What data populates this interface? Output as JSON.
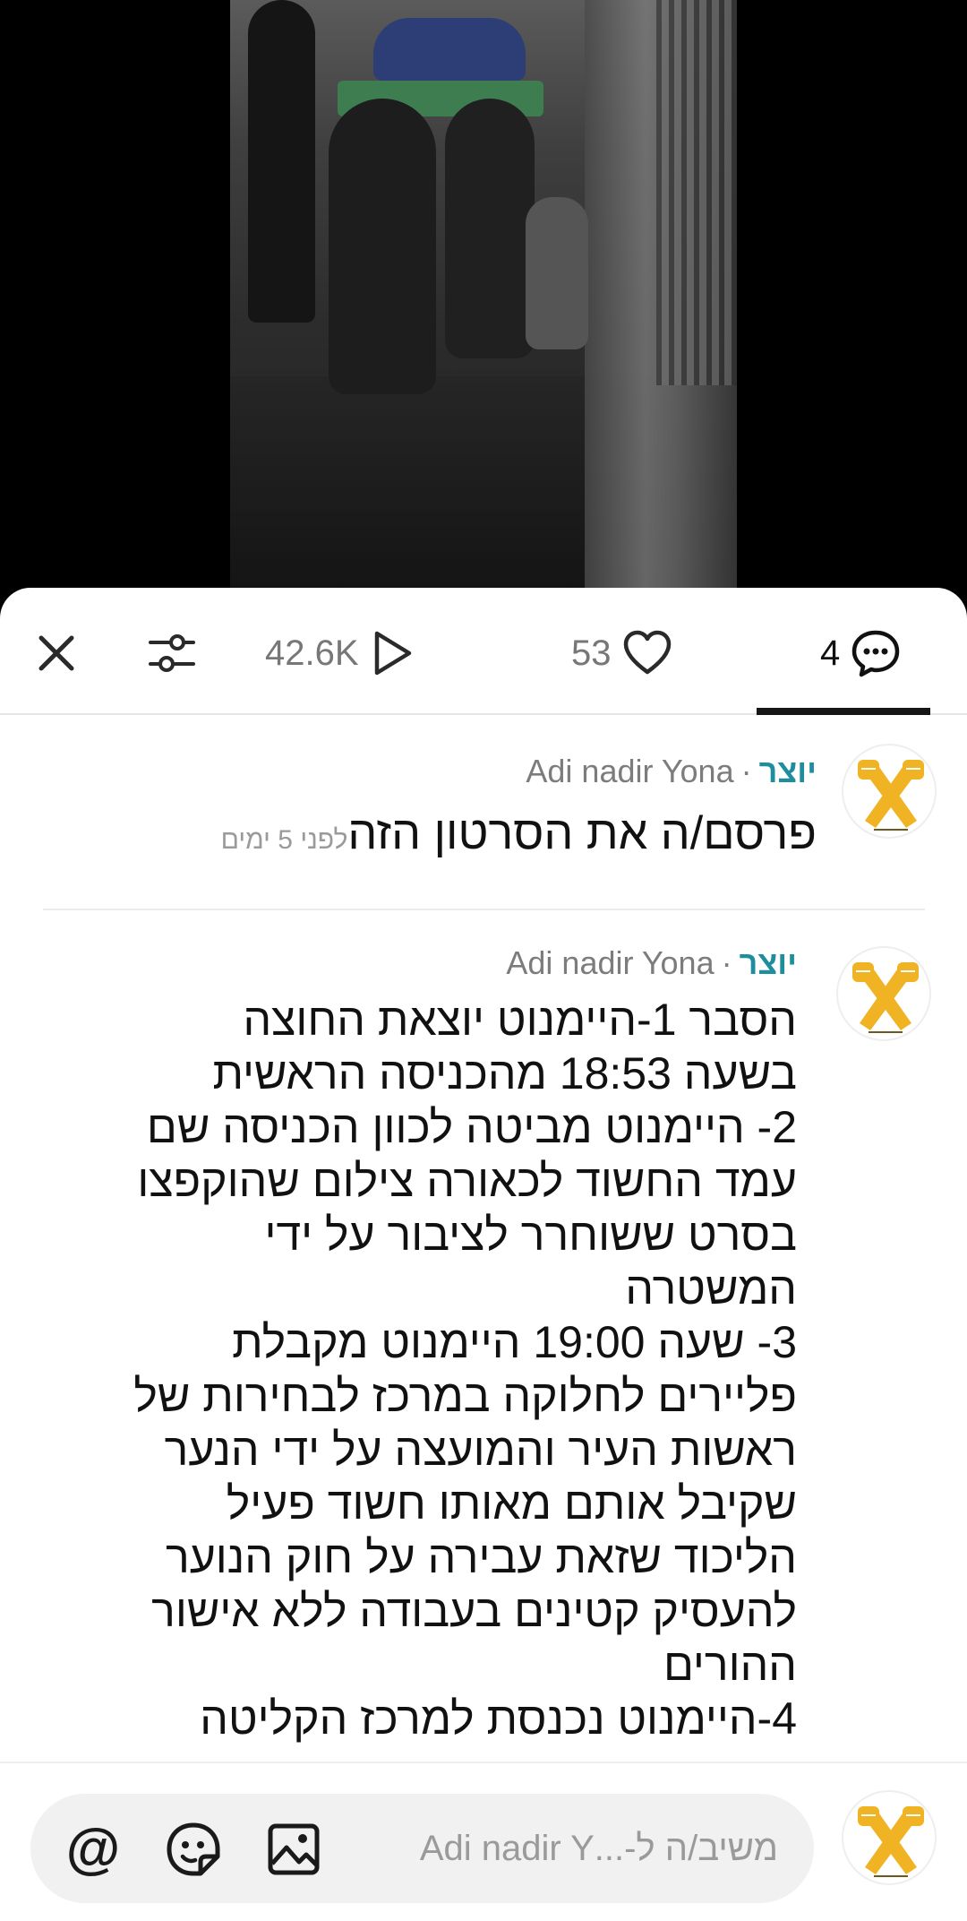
{
  "video": {
    "description_icon": "video-frame"
  },
  "tabs": {
    "views": "42.6K",
    "likes": "53",
    "comments": "4"
  },
  "comments": [
    {
      "author": "Adi nadir Yona",
      "badge": "יוצר",
      "separator": "·",
      "body": "פרסם/ה את הסרטון הזה",
      "time": "לפני 5 ימים"
    },
    {
      "author": "Adi nadir Yona",
      "badge": "יוצר",
      "separator": "·",
      "lines": [
        "הסבר 1-היימנוט יוצאת החוצה",
        "בשעה 18:53 מהכניסה הראשית",
        "2- היימנוט מביטה לכוון הכניסה שם",
        "עמד החשוד לכאורה צילום שהוקפצו",
        "בסרט ששוחרר לציבור על ידי",
        "המשטרה",
        "3- שעה 19:00 היימנוט מקבלת",
        "פליירים לחלוקה במרכז לבחירות של",
        "ראשות העיר והמועצה על ידי הנער",
        "שקיבל אותם מאותו חשוד פעיל",
        "הליכוד שזאת עבירה על חוק הנוער",
        "להעסיק קטינים בעבודה ללא אישור",
        "ההורים",
        "4-היימנוט נכנסת למרכז הקליטה"
      ]
    }
  ],
  "reply": {
    "placeholder": "משיב/ה ל-...Adi nadir Y",
    "at_symbol": "@"
  },
  "colors": {
    "creator_badge": "#1e8e9e",
    "avatar_yellow": "#f0b323"
  },
  "icons": [
    "close-icon",
    "filter-icon",
    "play-icon",
    "heart-icon",
    "comment-icon",
    "at-icon",
    "sticker-icon",
    "image-icon"
  ]
}
